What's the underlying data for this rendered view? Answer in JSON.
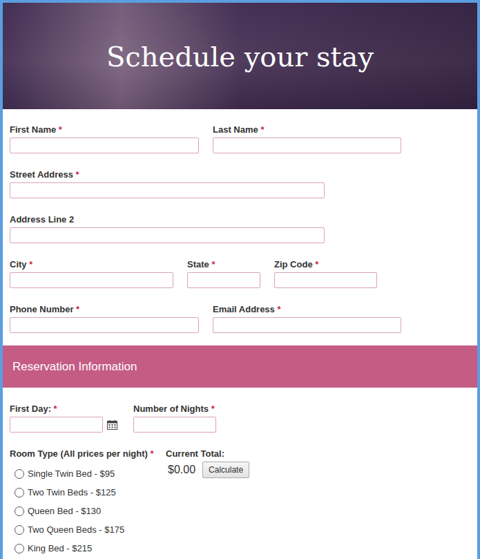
{
  "header": {
    "title": "Schedule your stay"
  },
  "required_mark": "*",
  "contact": {
    "first_name": {
      "label": "First Name",
      "required": true
    },
    "last_name": {
      "label": "Last Name",
      "required": true
    },
    "street": {
      "label": "Street Address",
      "required": true
    },
    "address2": {
      "label": "Address Line 2",
      "required": false
    },
    "city": {
      "label": "City",
      "required": true
    },
    "state": {
      "label": "State",
      "required": true
    },
    "zip": {
      "label": "Zip Code",
      "required": true
    },
    "phone": {
      "label": "Phone Number",
      "required": true
    },
    "email": {
      "label": "Email Address",
      "required": true
    }
  },
  "section": {
    "title": "Reservation Information"
  },
  "reservation": {
    "first_day": {
      "label": "First Day:",
      "required": true
    },
    "nights": {
      "label": "Number of Nights",
      "required": true
    },
    "room_type": {
      "label": "Room Type (All prices per night)",
      "required": true,
      "options": [
        {
          "label": "Single Twin Bed - $95",
          "selected": false
        },
        {
          "label": "Two Twin Beds - $125",
          "selected": false
        },
        {
          "label": "Queen Bed - $130",
          "selected": false
        },
        {
          "label": "Two Queen Beds - $175",
          "selected": false
        },
        {
          "label": "King Bed - $215",
          "selected": false
        }
      ]
    },
    "total": {
      "label": "Current Total:",
      "value": "$0.00",
      "button": "Calculate"
    }
  }
}
